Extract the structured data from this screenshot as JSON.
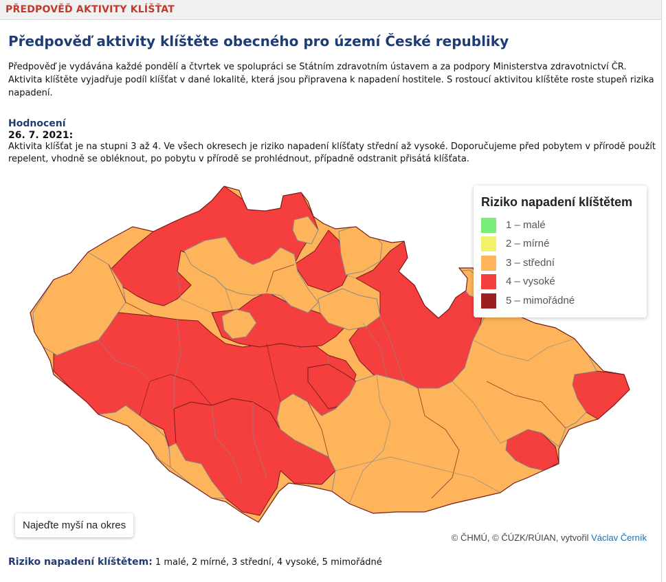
{
  "header": {
    "section_title": "PŘEDPOVĚĎ AKTIVITY KLÍŠŤAT"
  },
  "main": {
    "title": "Předpověď aktivity klíštěte obecného pro území České republiky",
    "intro": "Předpověď je vydávána každé pondělí a čtvrtek ve spolupráci se Státním zdravotním ústavem a za podpory Ministerstva zdravotnictví ČR. Aktivita klíštěte vyjadřuje podíl klíšťat v dané lokalitě, která jsou připravena k napadení hostitele. S rostoucí aktivitou klíštěte roste stupeň rizika napadení.",
    "assessment_heading": "Hodnocení",
    "date": "26. 7. 2021:",
    "summary": "Aktivita klíšťat je na stupni 3 až 4. Ve všech okresech je riziko napadení klíšťaty střední až vysoké. Doporučujeme před pobytem v přírodě použít repelent, vhodně se obléknout, po pobytu v přírodě se prohlédnout, případně odstranit přisátá klíšťata."
  },
  "map": {
    "legend": {
      "title": "Riziko napadení klíštětem",
      "items": [
        {
          "label": "1 – malé",
          "color": "#77ee77"
        },
        {
          "label": "2 – mírné",
          "color": "#f2f26a"
        },
        {
          "label": "3 – střední",
          "color": "#fdb45a"
        },
        {
          "label": "4 – vysoké",
          "color": "#f53e3e"
        },
        {
          "label": "5 – mimořádné",
          "color": "#9b1f1f"
        }
      ]
    },
    "hover_hint": "Najeďte myší na okres",
    "attribution_prefix": "© ČHMÚ, © ČÚZK/RÚIAN, vytvořil ",
    "attribution_link": "Václav Černík",
    "colors": {
      "medium": "#fdb45a",
      "high": "#f53e3e",
      "border_high": "#7a1a1a",
      "border_medium": "#8a8a8a"
    }
  },
  "footer": {
    "label": "Riziko napadení klíštětem:",
    "text": " 1 malé, 2 mírné, 3 střední, 4 vysoké, 5 mimořádné"
  }
}
